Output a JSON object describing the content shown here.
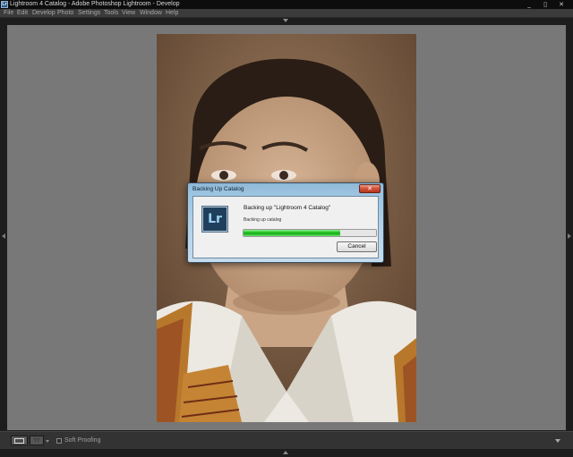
{
  "window": {
    "title": "Lightroom 4 Catalog - Adobe Photoshop Lightroom - Develop",
    "app_icon_label": "Lr",
    "controls": {
      "minimize": "_",
      "maximize": "▯",
      "close": "✕"
    }
  },
  "menu": {
    "items": [
      "File",
      "Edit",
      "Develop",
      "Photo",
      "Settings",
      "Tools",
      "View",
      "Window",
      "Help"
    ]
  },
  "dialog": {
    "title": "Backing Up Catalog",
    "close_label": "✕",
    "logo_label": "Lr",
    "heading": "Backing up \"Lightroom 4 Catalog\"",
    "status": "Backing up catalog",
    "progress": 0.73,
    "cancel_label": "Cancel"
  },
  "toolbar": {
    "loupe_view_icon": "loupe-view-icon",
    "before_after_label": "YY",
    "soft_proofing_label": "Soft Proofing",
    "soft_proofing_checked": false
  },
  "colors": {
    "progress_green": "#1fc21f",
    "dialog_frame": "#9ac2df",
    "close_red": "#d2533b",
    "canvas_gray": "#787878"
  }
}
